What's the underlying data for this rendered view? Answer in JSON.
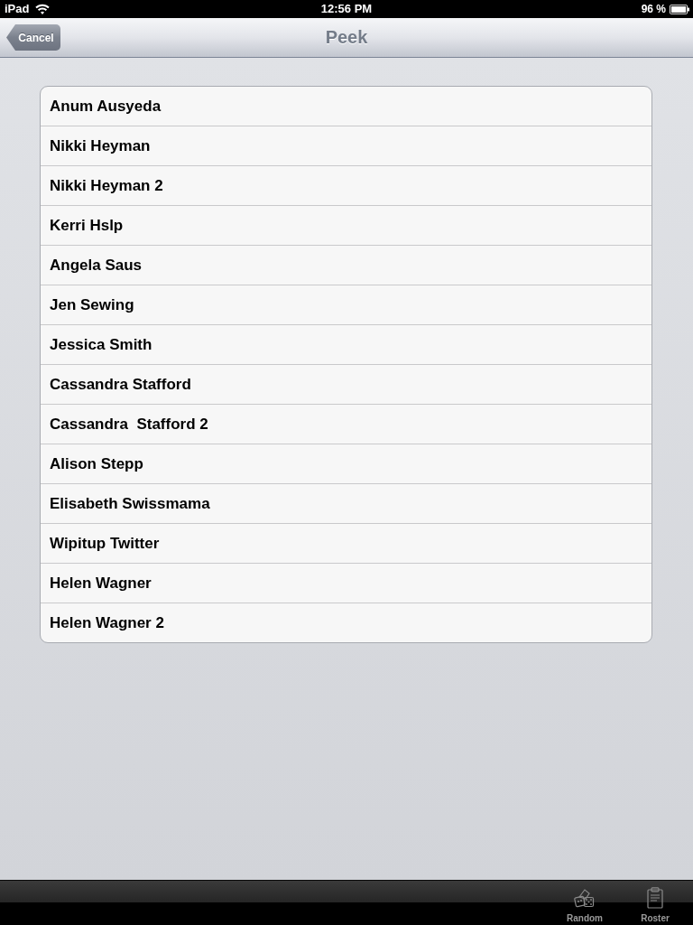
{
  "status_bar": {
    "device": "iPad",
    "time": "12:56 PM",
    "battery": "96 %"
  },
  "nav_bar": {
    "back_button": "Cancel",
    "title": "Peek"
  },
  "list": [
    "Anum Ausyeda",
    "Nikki Heyman",
    "Nikki Heyman 2",
    "Kerri Hslp",
    "Angela Saus",
    "Jen Sewing",
    "Jessica Smith",
    "Cassandra Stafford",
    "Cassandra  Stafford 2",
    "Alison Stepp",
    "Elisabeth Swissmama",
    "Wipitup Twitter",
    "Helen Wagner",
    "Helen Wagner 2"
  ],
  "toolbar": {
    "items": [
      {
        "label": "Random",
        "kind": "dice"
      },
      {
        "label": "Roster",
        "kind": "clipboard"
      }
    ]
  }
}
